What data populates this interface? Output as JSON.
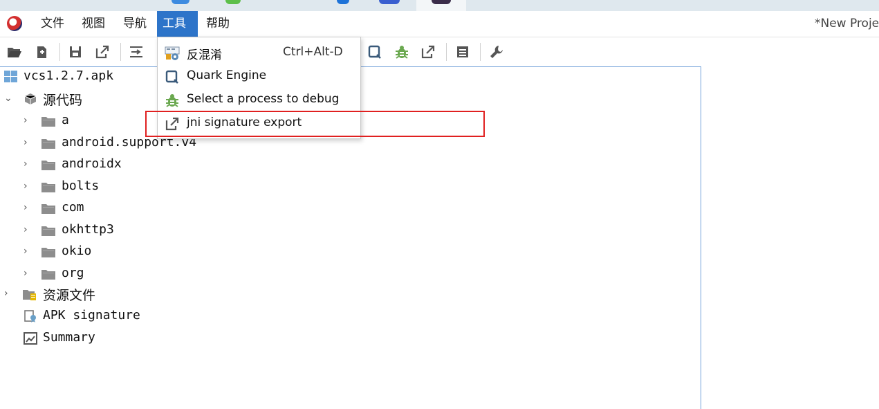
{
  "menubar": {
    "items": [
      {
        "label": "文件"
      },
      {
        "label": "视图"
      },
      {
        "label": "导航"
      },
      {
        "label": "工具"
      },
      {
        "label": "帮助"
      }
    ],
    "title": "*New Proje"
  },
  "tools_menu": {
    "items": [
      {
        "label": "反混淆",
        "shortcut": "Ctrl+Alt-D",
        "icon": "deobfuscate-icon"
      },
      {
        "label": "Quark Engine",
        "icon": "quark-engine-icon"
      },
      {
        "label": "Select a process to debug",
        "icon": "bug-icon"
      },
      {
        "label": "jni signature export",
        "icon": "export-icon"
      }
    ]
  },
  "tree": {
    "root": "vcs1.2.7.apk",
    "source_node": "源代码",
    "packages": [
      "a",
      "android.support.v4",
      "androidx",
      "bolts",
      "com",
      "okhttp3",
      "okio",
      "org"
    ],
    "resources_node": "资源文件",
    "apk_signature": "APK signature",
    "summary": "Summary"
  },
  "colors": {
    "menu_active": "#2d74c9",
    "highlight_border": "#e02020",
    "editor_border": "#6f9ed8"
  }
}
